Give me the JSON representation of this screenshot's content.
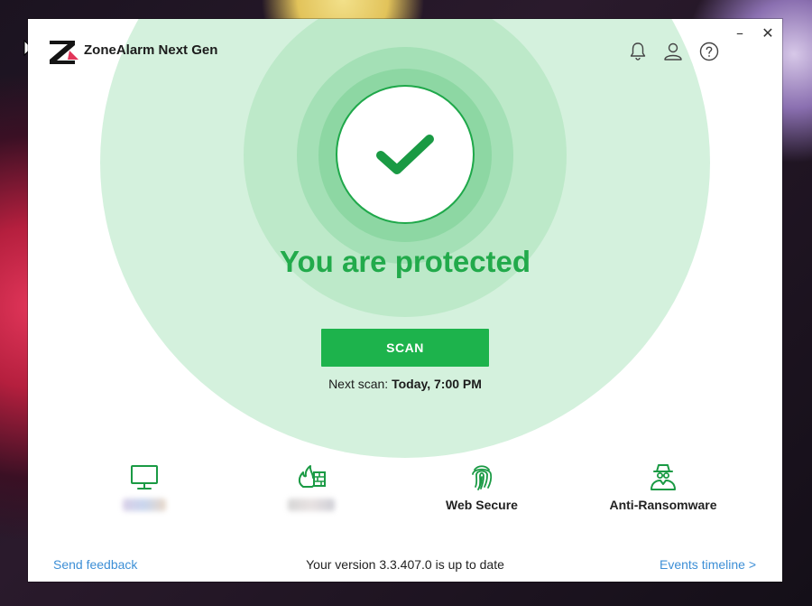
{
  "app": {
    "title": "ZoneAlarm Next Gen",
    "logo_icon": "zonealarm-z-logo"
  },
  "header": {
    "icons": [
      "bell-icon",
      "user-icon",
      "help-icon"
    ]
  },
  "window_controls": {
    "minimize": "–",
    "close": "✕"
  },
  "status": {
    "title": "You are protected",
    "icon": "checkmark-icon",
    "color": "#22aa4b"
  },
  "scan": {
    "button_label": "SCAN",
    "next_scan_prefix": "Next scan: ",
    "next_scan_value": "Today, 7:00 PM"
  },
  "features": [
    {
      "icon": "monitor-icon",
      "label": "",
      "label_blurred": true
    },
    {
      "icon": "firewall-icon",
      "label": "",
      "label_blurred": true
    },
    {
      "icon": "fingerprint-icon",
      "label": "Web Secure"
    },
    {
      "icon": "spy-agent-icon",
      "label": "Anti-Ransomware"
    }
  ],
  "footer": {
    "feedback_link": "Send feedback",
    "version_text": "Your version 3.3.407.0 is up to date",
    "events_link": "Events timeline >"
  },
  "colors": {
    "accent_green": "#1db34c",
    "link_blue": "#3d8fd6"
  }
}
